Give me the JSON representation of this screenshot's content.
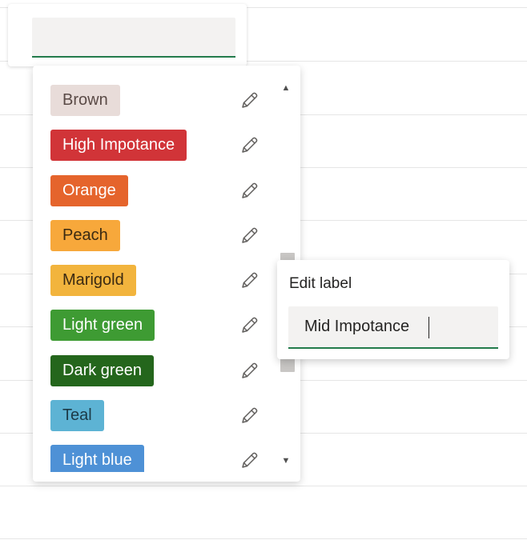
{
  "search": {
    "value": "",
    "placeholder": ""
  },
  "labels": [
    {
      "name": "Brown",
      "bg": "#e8dcd9",
      "fg": "#5a4a46",
      "edit_icon": "pencil-icon"
    },
    {
      "name": "High Impotance",
      "bg": "#d13438",
      "fg": "#ffffff",
      "edit_icon": "pencil-icon"
    },
    {
      "name": "Orange",
      "bg": "#e5642c",
      "fg": "#ffffff",
      "edit_icon": "pencil-icon"
    },
    {
      "name": "Peach",
      "bg": "#f7a83b",
      "fg": "#3b2a12",
      "edit_icon": "pencil-icon"
    },
    {
      "name": "Marigold",
      "bg": "#f2b43d",
      "fg": "#3b2a12",
      "edit_icon": "pencil-icon"
    },
    {
      "name": "Light green",
      "bg": "#3e9b33",
      "fg": "#ffffff",
      "edit_icon": "pencil-icon"
    },
    {
      "name": "Dark green",
      "bg": "#24661c",
      "fg": "#ffffff",
      "edit_icon": "pencil-icon"
    },
    {
      "name": "Teal",
      "bg": "#5db3d4",
      "fg": "#1c3a47",
      "edit_icon": "pencil-icon"
    },
    {
      "name": "Light blue",
      "bg": "#4e91d6",
      "fg": "#ffffff",
      "edit_icon": "pencil-icon"
    }
  ],
  "scrollbar": {
    "up_icon": "caret-up-icon",
    "down_icon": "caret-down-icon",
    "up_glyph": "▲",
    "down_glyph": "▼"
  },
  "edit_label": {
    "title": "Edit label",
    "value": "Mid Impotance"
  },
  "colors": {
    "accent": "#237b4b",
    "input_bg": "#f3f2f1"
  }
}
